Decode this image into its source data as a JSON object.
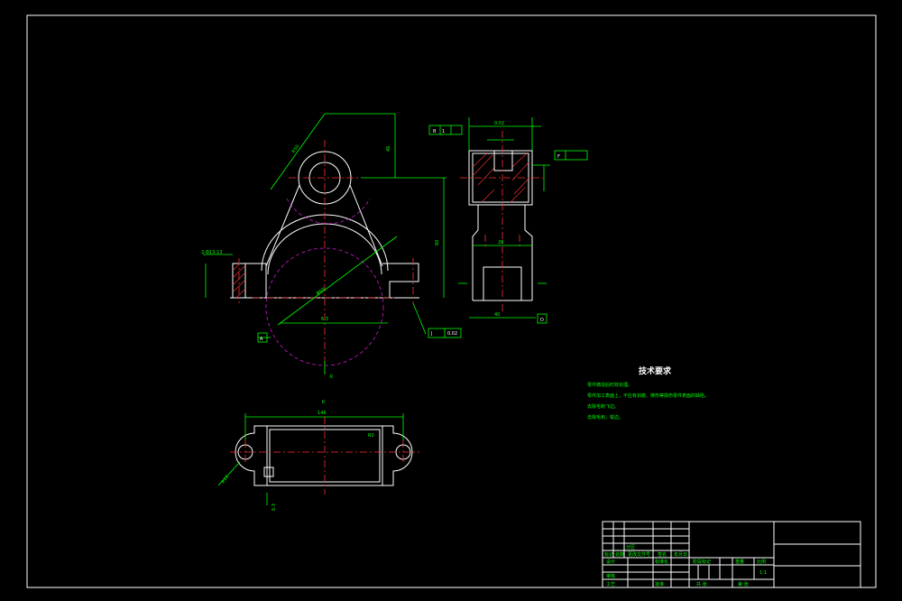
{
  "sheet": {
    "background": "#000000",
    "line_color": "#ffffff",
    "dimension_color": "#00ff00",
    "centerline_color": "#ff3030",
    "phantom_color": "#d01ad0"
  },
  "technical_requirements": {
    "title": "技术要求",
    "items": [
      "零件铸造后时效处理。",
      "零件加工表面上，不应有划痕、擦伤等损伤零件表面的缺陷。",
      "去除毛刺飞边。",
      "去除毛刺，锐边。"
    ]
  },
  "front_view": {
    "labels": {
      "height_dim": "46",
      "radius_dim": "R50",
      "bore_dim": "Φ60",
      "depth_dim": "60",
      "cut_label": "K",
      "bottom_dim": "6.3",
      "left_dim": "2-Φ13-13",
      "datum_a": "A",
      "datum_j": "J",
      "tol_value": "0.02"
    }
  },
  "side_view": {
    "labels": {
      "top_dim": "0.02",
      "datum_b": "B",
      "datum_f": "F",
      "width_dim": "28",
      "bottom_dim": "40",
      "datum_d": "D",
      "tol_ref": "1"
    }
  },
  "bottom_view": {
    "labels": {
      "length_dim": "146",
      "top_label": "K",
      "radius_label": "R2",
      "left_dim": "R12",
      "small_dim": "6.3"
    }
  },
  "title_block": {
    "cells": {
      "mark": "标记",
      "count": "处数",
      "partition": "分区",
      "change_doc": "更改文件号",
      "signature": "签名",
      "date": "年月日",
      "design": "设计",
      "standard": "标准化",
      "stage_mark": "阶段标记",
      "weight": "重量",
      "scale": "比例",
      "scale_value": "1:1",
      "review": "审核",
      "process": "工艺",
      "approve": "批准",
      "sheets": "共 张",
      "sheet_no": "第 张"
    }
  }
}
